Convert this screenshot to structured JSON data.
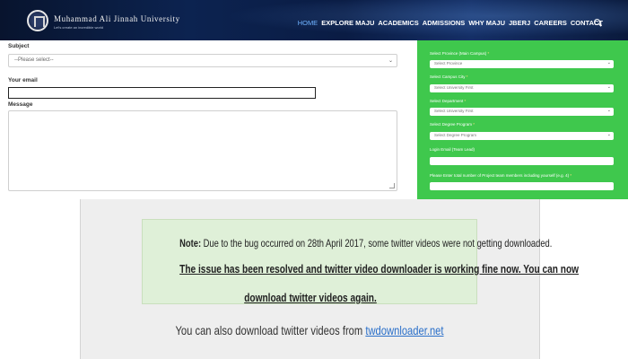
{
  "header": {
    "university_name": "Muhammad Ali Jinnah University",
    "tagline": "Let's create an incredible world",
    "nav": [
      "HOME",
      "EXPLORE MAJU",
      "ACADEMICS",
      "ADMISSIONS",
      "WHY MAJU",
      "JBERJ",
      "CAREERS",
      "CONTACT"
    ],
    "active_nav": "HOME"
  },
  "contact_form": {
    "subject_label": "Subject",
    "subject_value": "--Please select--",
    "email_label": "Your email",
    "email_value": "",
    "message_label": "Message",
    "message_value": ""
  },
  "registration_panel": {
    "province_label": "Select Province (Main Campus)",
    "province_value": "Select Province",
    "campus_label": "Select Campus City",
    "campus_value": "Select University First",
    "department_label": "Select Department",
    "department_value": "Select University First",
    "program_label": "Select Degree Program",
    "program_value": "Select Degree Program",
    "email_label": "Login Email (Team Lead)",
    "members_label": "Please Enter total number of Project team members including yourself (e.g. 4)",
    "required_mark": "*"
  },
  "notice": {
    "note_prefix": "Note:",
    "line1": "Due to the bug occurred on 28th April 2017, some twitter videos were not getting downloaded.",
    "line2": "The issue has been resolved and twitter video downloader is working fine now. You can now",
    "line3": "download twitter videos again.",
    "alt_text": "You can also download twitter videos from",
    "alt_link": "twdownloader.net"
  },
  "colors": {
    "panel_green": "#3fc84d",
    "notice_bg": "#dff0d8",
    "link": "#2a6fc9",
    "nav_active": "#6fb2ff"
  }
}
